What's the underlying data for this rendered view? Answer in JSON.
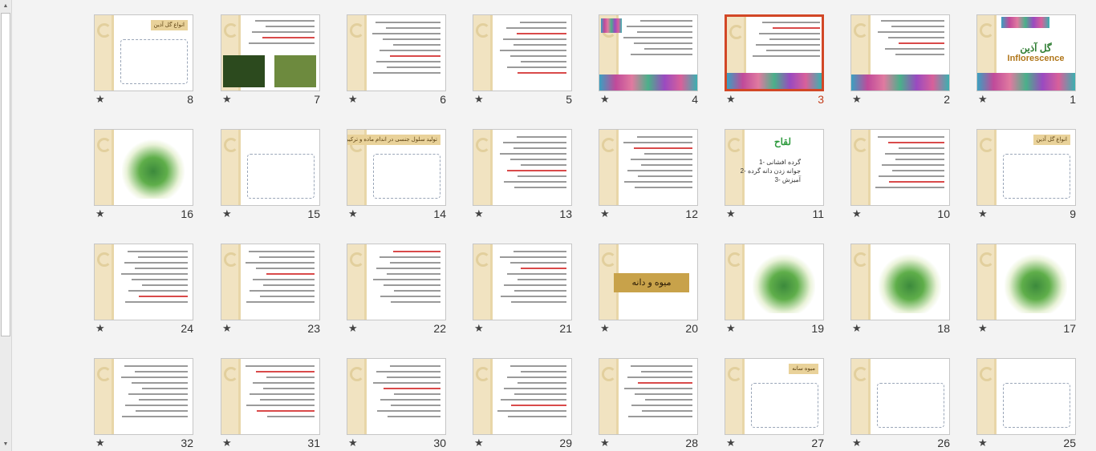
{
  "slides": [
    {
      "number": "1",
      "star": "★",
      "type": "title",
      "title": "گل آذین",
      "subtitle": "Inflorescence"
    },
    {
      "number": "2",
      "star": "★",
      "type": "text-flowers"
    },
    {
      "number": "3",
      "star": "★",
      "type": "text-flowers",
      "selected": true
    },
    {
      "number": "4",
      "star": "★",
      "type": "text-flowers-left"
    },
    {
      "number": "5",
      "star": "★",
      "type": "text"
    },
    {
      "number": "6",
      "star": "★",
      "type": "text"
    },
    {
      "number": "7",
      "star": "★",
      "type": "text-photos"
    },
    {
      "number": "8",
      "star": "★",
      "type": "diagram",
      "title": "انواع گل آذین"
    },
    {
      "number": "9",
      "star": "★",
      "type": "diagram",
      "title": "انواع گل آذین"
    },
    {
      "number": "10",
      "star": "★",
      "type": "text"
    },
    {
      "number": "11",
      "star": "★",
      "type": "heading",
      "title": "لقاح",
      "lines": [
        "1- گرده افشانی",
        "2- جوانه زدن دانه گرده",
        "3- آمیزش"
      ]
    },
    {
      "number": "12",
      "star": "★",
      "type": "text"
    },
    {
      "number": "13",
      "star": "★",
      "type": "text"
    },
    {
      "number": "14",
      "star": "★",
      "type": "diagram",
      "title": "تولید سلول جنسی در اندام ماده و ترکیباهان"
    },
    {
      "number": "15",
      "star": "★",
      "type": "diagram"
    },
    {
      "number": "16",
      "star": "★",
      "type": "image"
    },
    {
      "number": "17",
      "star": "★",
      "type": "image"
    },
    {
      "number": "18",
      "star": "★",
      "type": "image"
    },
    {
      "number": "19",
      "star": "★",
      "type": "image"
    },
    {
      "number": "20",
      "star": "★",
      "type": "title-box",
      "title": "میوه و دانه"
    },
    {
      "number": "21",
      "star": "★",
      "type": "text"
    },
    {
      "number": "22",
      "star": "★",
      "type": "text"
    },
    {
      "number": "23",
      "star": "★",
      "type": "text"
    },
    {
      "number": "24",
      "star": "★",
      "type": "text"
    },
    {
      "number": "25",
      "star": "★",
      "type": "diagram"
    },
    {
      "number": "26",
      "star": "★",
      "type": "diagram"
    },
    {
      "number": "27",
      "star": "★",
      "type": "diagram",
      "title": "میوه سانه"
    },
    {
      "number": "28",
      "star": "★",
      "type": "text"
    },
    {
      "number": "29",
      "star": "★",
      "type": "text"
    },
    {
      "number": "30",
      "star": "★",
      "type": "text"
    },
    {
      "number": "31",
      "star": "★",
      "type": "text"
    },
    {
      "number": "32",
      "star": "★",
      "type": "text"
    }
  ]
}
